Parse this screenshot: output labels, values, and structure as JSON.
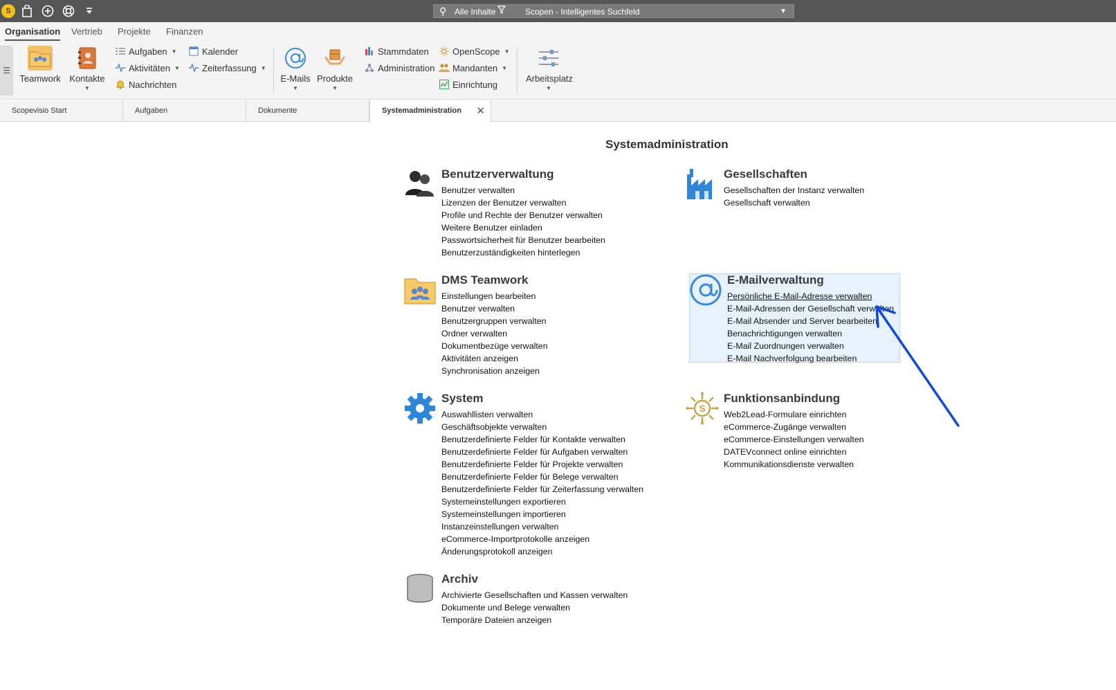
{
  "topbar": {
    "search_filter": "Alle Inhalte",
    "search_placeholder": "Scopen - Intelligentes Suchfeld"
  },
  "menu_tabs": [
    "Organisation",
    "Vertrieb",
    "Projekte",
    "Finanzen"
  ],
  "ribbon": {
    "teamwork": "Teamwork",
    "kontakte": "Kontakte",
    "aufgaben": "Aufgaben",
    "aktivitaeten": "Aktivitäten",
    "nachrichten": "Nachrichten",
    "kalender": "Kalender",
    "zeiterfassung": "Zeiterfassung",
    "emails": "E-Mails",
    "produkte": "Produkte",
    "stammdaten": "Stammdaten",
    "administration": "Administration",
    "openscope": "OpenScope",
    "mandanten": "Mandanten",
    "einrichtung": "Einrichtung",
    "arbeitsplatz": "Arbeitsplatz"
  },
  "doc_tabs": [
    "Scopevisio Start",
    "Aufgaben",
    "Dokumente",
    "Systemadministration"
  ],
  "page": {
    "title": "Systemadministration"
  },
  "sections": {
    "benutzer": {
      "title": "Benutzerverwaltung",
      "items": [
        "Benutzer verwalten",
        "Lizenzen der Benutzer verwalten",
        "Profile und Rechte der Benutzer verwalten",
        "Weitere Benutzer einladen",
        "Passwortsicherheit für Benutzer bearbeiten",
        "Benutzerzuständigkeiten hinterlegen"
      ]
    },
    "gesellschaften": {
      "title": "Gesellschaften",
      "items": [
        "Gesellschaften der Instanz verwalten",
        "Gesellschaft verwalten"
      ]
    },
    "dms": {
      "title": "DMS Teamwork",
      "items": [
        "Einstellungen bearbeiten",
        "Benutzer verwalten",
        "Benutzergruppen verwalten",
        "Ordner verwalten",
        "Dokumentbezüge verwalten",
        "Aktivitäten anzeigen",
        "Synchronisation anzeigen"
      ]
    },
    "email": {
      "title": "E-Mailverwaltung",
      "items": [
        "Persönliche E-Mail-Adresse verwalten",
        "E-Mail-Adressen der Gesellschaft verwalten",
        "E-Mail Absender und Server bearbeiten",
        "Benachrichtigungen verwalten",
        "E-Mail Zuordnungen verwalten",
        "E-Mail Nachverfolgung bearbeiten"
      ]
    },
    "system": {
      "title": "System",
      "items": [
        "Auswahllisten verwalten",
        "Geschäftsobjekte verwalten",
        "Benutzerdefinierte Felder für Kontakte verwalten",
        "Benutzerdefinierte Felder für Aufgaben verwalten",
        "Benutzerdefinierte Felder für Projekte verwalten",
        "Benutzerdefinierte Felder für Belege verwalten",
        "Benutzerdefinierte Felder für Zeiterfassung verwalten",
        "Systemeinstellungen exportieren",
        "Systemeinstellungen importieren",
        "Instanzeinstellungen verwalten",
        "eCommerce-Importprotokolle anzeigen",
        "Änderungsprotokoll anzeigen"
      ]
    },
    "funktion": {
      "title": "Funktionsanbindung",
      "items": [
        "Web2Lead-Formulare einrichten",
        "eCommerce-Zugänge verwalten",
        "eCommerce-Einstellungen verwalten",
        "DATEVconnect online einrichten",
        "Kommunikationsdienste verwalten"
      ]
    },
    "archiv": {
      "title": "Archiv",
      "items": [
        "Archivierte Gesellschaften und Kassen verwalten",
        "Dokumente und Belege verwalten",
        "Temporäre Dateien anzeigen"
      ]
    }
  },
  "colors": {
    "topbar": "#565656",
    "ribbon": "#f3f3f3",
    "highlight": "#e6f1fb",
    "annotation_arrow": "#1149d4"
  }
}
